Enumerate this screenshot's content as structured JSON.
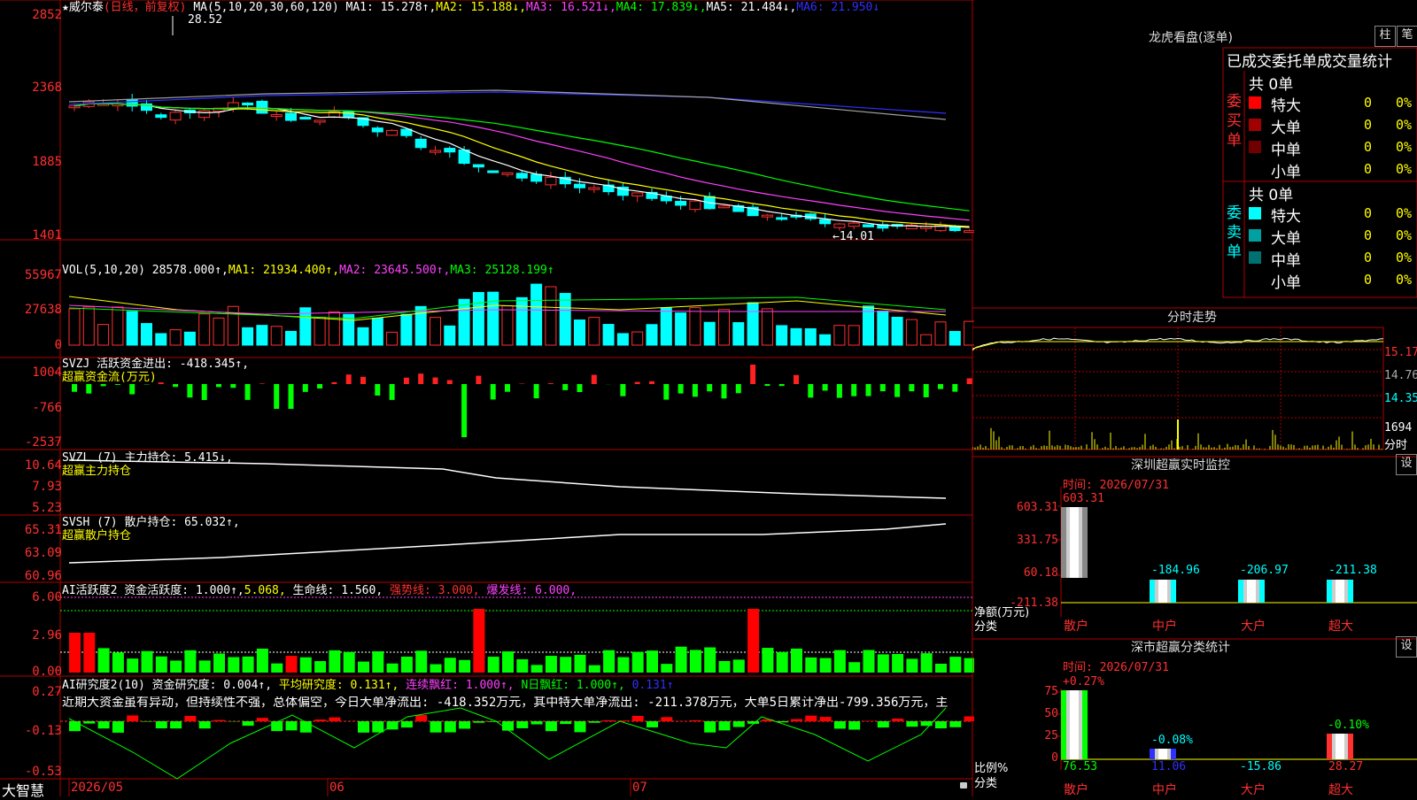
{
  "colors": {
    "up": "#ff3030",
    "down": "#00ffff",
    "grid": "#b00000",
    "bg": "#000000"
  },
  "main": {
    "star": "★",
    "stock": "威尔泰",
    "period": "(日线，前复权)",
    "ma_label": "MA(5,10,20,30,60,120)",
    "ma1": "MA1: 15.278↑,",
    "ma2": "MA2: 15.188↓,",
    "ma3": "MA3: 16.521↓,",
    "ma4": "MA4: 17.839↓,",
    "ma5": "MA5: 21.484↓,",
    "ma6": "MA6: 21.950↓",
    "high_note": "28.52",
    "low_note": "←14.01",
    "yticks": [
      "2852",
      "2368",
      "1885",
      "1401"
    ]
  },
  "vol": {
    "label": "VOL(5,10,20)",
    "v": "28578.000↑,",
    "ma1": "MA1: 21934.400↑,",
    "ma2": "MA2: 23645.500↑,",
    "ma3": "MA3: 25128.199↑",
    "yticks": [
      "55967",
      "27638",
      "0"
    ]
  },
  "svzj": {
    "label": "SVZJ  活跃资金进出: -418.345↑,",
    "sub": "超赢资金流(万元)",
    "yticks": [
      "1004",
      "-766",
      "-2537"
    ]
  },
  "svzl": {
    "label": "SVZL (7) 主力持仓: 5.415↓,",
    "sub": "超赢主力持仓",
    "yticks": [
      "10.64",
      "7.93",
      "5.23"
    ]
  },
  "svsh": {
    "label": "SVSH (7) 散户持仓: 65.032↑,",
    "sub": "超赢散户持仓",
    "yticks": [
      "65.31",
      "63.09",
      "60.96"
    ]
  },
  "ai1": {
    "label": "AI活跃度2 资金活跃度: 1.000↑,",
    "v2": "5.068,",
    "life": "生命线: 1.560,",
    "strong": "强势线: 3.000,",
    "burst": "爆发线: 6.000,",
    "yticks": [
      "6.00",
      "2.96",
      "0.00"
    ]
  },
  "ai2": {
    "label": "AI研究度2(10) 资金研究度: 0.004↑,",
    "avg": "平均研究度: 0.131↑,",
    "lian": "连续飘红: 1.000↑,",
    "nday": "N日飘红: 1.000↑,",
    "last": "0.131↑",
    "comment": "近期大资金虽有异动，但持续性不强，总体偏空，今日大单净流出: -418.352万元，其中特大单净流出: -211.378万元，大单5日累计净出-799.356万元，主",
    "yticks": [
      "0.27",
      "-0.13",
      "-0.53"
    ]
  },
  "bottom": {
    "brand": "大智慧",
    "dates": [
      "2026/05",
      "06",
      "07"
    ]
  },
  "right": {
    "lhb_title": "龙虎看盘(逐单)",
    "btn_zhu": "柱",
    "btn_bi": "笔",
    "subtitle": "已成交委托单成交量统计",
    "buy_side": "委买单",
    "sell_side": "委卖单",
    "buy_total": "共 0单",
    "sell_total": "共 0单",
    "rows": [
      {
        "name": "特大",
        "n": "0",
        "p": "0%"
      },
      {
        "name": "大单",
        "n": "0",
        "p": "0%"
      },
      {
        "name": "中单",
        "n": "0",
        "p": "0%"
      },
      {
        "name": "小单",
        "n": "0",
        "p": "0%"
      }
    ],
    "fenshi_title": "分时走势",
    "fenshi_y": [
      "15.17",
      "14.76",
      "14.35",
      "1694",
      "分时"
    ],
    "sz_title": "深圳超赢实时监控",
    "set1": "设",
    "sz_time": "时间: 2026/07/31",
    "sz_y": [
      "603.31",
      "331.75",
      "60.18",
      "-211.38"
    ],
    "sz_unit1": "净额(万元)",
    "sz_unit2": "分类",
    "sz_vals": [
      "603.31",
      "-184.96",
      "-206.97",
      "-211.38"
    ],
    "cats": [
      "散户",
      "中户",
      "大户",
      "超大"
    ],
    "fl_title": "深市超赢分类统计",
    "set2": "设",
    "fl_time": "时间: 2026/07/31",
    "fl_y": [
      "75",
      "50",
      "25",
      "0"
    ],
    "fl_top": [
      "+0.27%",
      "-0.08%",
      "-0.10%"
    ],
    "fl_unit1": "比例%",
    "fl_unit2": "分类",
    "fl_vals": [
      "76.53",
      "11.06",
      "-15.86",
      "28.27"
    ]
  }
}
